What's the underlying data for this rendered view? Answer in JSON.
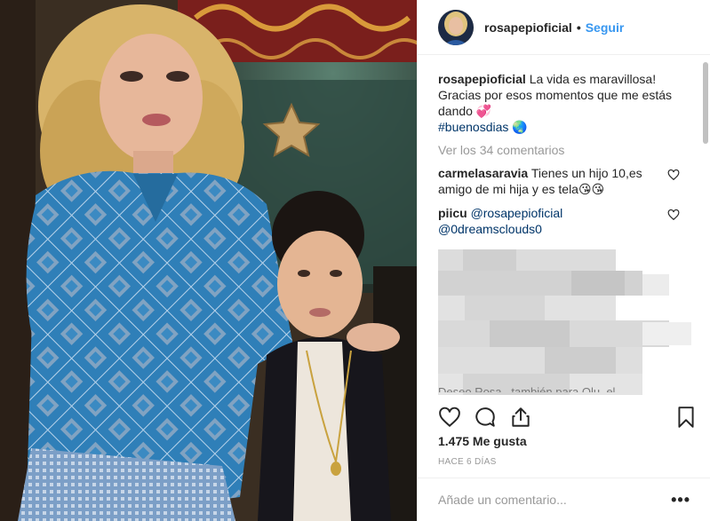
{
  "post": {
    "username": "rosapepioficial",
    "separator": "•",
    "follow_label": "Seguir",
    "caption": {
      "username": "rosapepioficial",
      "text_line1": "La vida es maravillosa!",
      "text_line2": "Gracias por esos momentos que me estás",
      "text_line3": "dando",
      "emoji_heart": "💞",
      "hashtag": "#buenosdias",
      "emoji_globe": "🌏"
    },
    "view_all_comments": "Ver los 34 comentarios",
    "comments": [
      {
        "username": "carmelasaravia",
        "text": "Tienes un hijo 10,es amigo de mi hija y es tela😘😘"
      },
      {
        "username": "piicu",
        "mention1": "@rosapepioficial",
        "mention2": "@0dreamsclouds0"
      }
    ],
    "truncated_line": "Deseo Rosa , también para Olu, el",
    "likes": "1.475 Me gusta",
    "date": "HACE 6 DÍAS",
    "add_comment_placeholder": "Añade un comentario...",
    "more_label": "•••",
    "icons": {
      "avatar": "profile-avatar",
      "like": "heart-outline-icon",
      "comment": "speech-bubble-icon",
      "share": "share-upload-icon",
      "save": "bookmark-icon",
      "comment_like": "small-heart-icon",
      "more": "ellipsis-icon"
    },
    "colors": {
      "follow_blue": "#3897f0",
      "hashtag_blue": "#003569",
      "muted_gray": "#999999",
      "border": "#efefef"
    }
  }
}
